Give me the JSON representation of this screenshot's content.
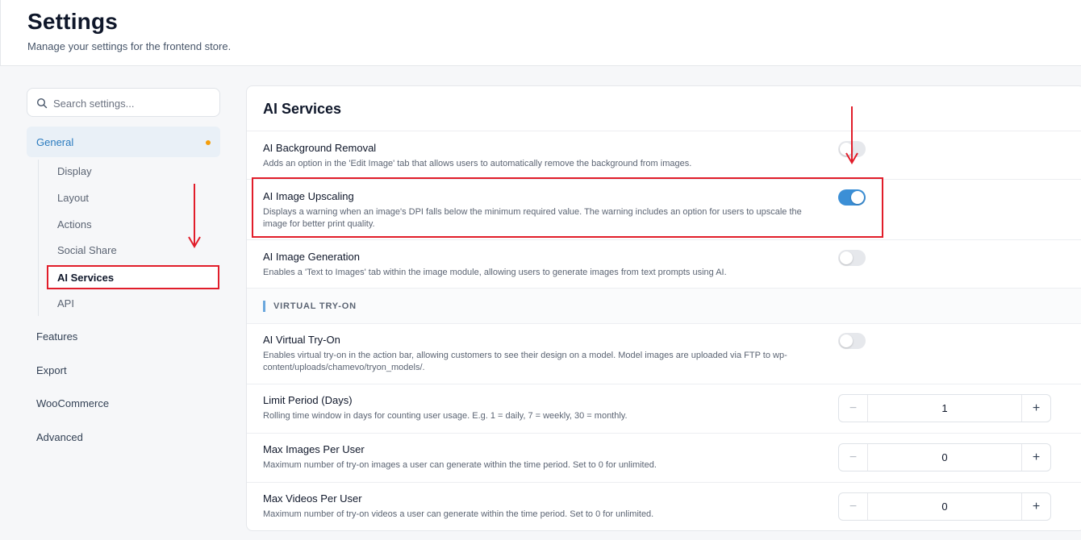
{
  "header": {
    "title": "Settings",
    "subtitle": "Manage your settings for the frontend store."
  },
  "sidebar": {
    "search_placeholder": "Search settings...",
    "general": {
      "label": "General",
      "dot_color": "#f59e0b"
    },
    "sub_items": [
      "Display",
      "Layout",
      "Actions",
      "Social Share",
      "AI Services",
      "API"
    ],
    "active_sub_item": "AI Services",
    "top_items": [
      "Features",
      "Export",
      "WooCommerce",
      "Advanced"
    ]
  },
  "main": {
    "title": "AI Services",
    "rows": [
      {
        "title": "AI Background Removal",
        "desc": "Adds an option in the 'Edit Image' tab that allows users to automatically remove the background from images.",
        "enabled": false
      },
      {
        "title": "AI Image Upscaling",
        "desc": "Displays a warning when an image's DPI falls below the minimum required value. The warning includes an option for users to upscale the image for better print quality.",
        "enabled": true
      },
      {
        "title": "AI Image Generation",
        "desc": "Enables a 'Text to Images' tab within the image module, allowing users to generate images from text prompts using AI.",
        "enabled": false
      }
    ],
    "section_label": "VIRTUAL TRY-ON",
    "tryon": {
      "title": "AI Virtual Try-On",
      "desc": "Enables virtual try-on in the action bar, allowing customers to see their design on a model. Model images are uploaded via FTP to wp-content/uploads/chamevo/tryon_models/.",
      "enabled": false
    },
    "numbers": [
      {
        "title": "Limit Period (Days)",
        "desc": "Rolling time window in days for counting user usage. E.g. 1 = daily, 7 = weekly, 30 = monthly.",
        "value": "1"
      },
      {
        "title": "Max Images Per User",
        "desc": "Maximum number of try-on images a user can generate within the time period. Set to 0 for unlimited.",
        "value": "0"
      },
      {
        "title": "Max Videos Per User",
        "desc": "Maximum number of try-on videos a user can generate within the time period. Set to 0 for unlimited.",
        "value": "0"
      }
    ],
    "stepper_minus": "−",
    "stepper_plus": "+"
  },
  "colors": {
    "accent": "#3b8fd6",
    "annotation_red": "#e11d2a"
  }
}
